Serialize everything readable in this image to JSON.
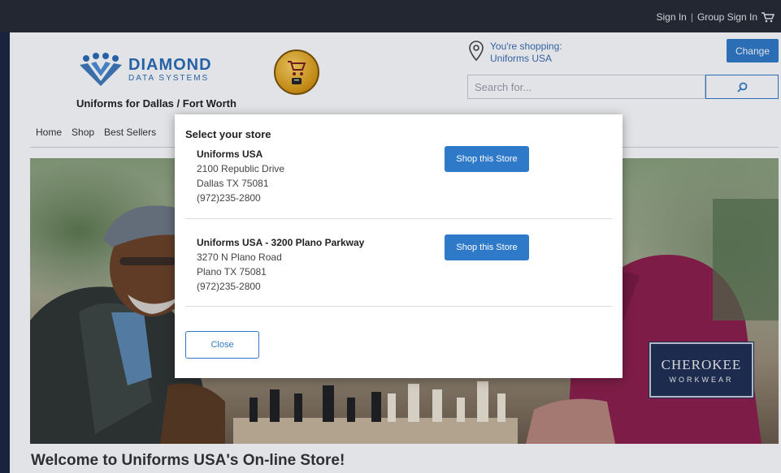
{
  "topbar": {
    "sign_in": "Sign In",
    "separator": "|",
    "group_sign_in": "Group Sign In",
    "cart_icon": "cart-icon"
  },
  "header": {
    "logo": {
      "line1": "DIAMOND",
      "line2": "DATA SYSTEMS"
    },
    "tagline": "Uniforms for Dallas / Fort Worth",
    "location": {
      "line1": "You're shopping:",
      "line2": "Uniforms USA",
      "icon": "map-pin-icon"
    },
    "change_label": "Change",
    "search": {
      "placeholder": "Search for...",
      "icon": "search-icon"
    }
  },
  "nav": {
    "items": [
      "Home",
      "Shop",
      "Best Sellers"
    ]
  },
  "hero": {
    "brand": {
      "line1": "CHEROKEE",
      "line2": "WORKWEAR"
    }
  },
  "welcome": "Welcome to Uniforms USA's On-line Store!",
  "modal": {
    "title": "Select your store",
    "stores": [
      {
        "name": "Uniforms USA",
        "address": "2100 Republic Drive",
        "city": "Dallas TX 75081",
        "phone": "(972)235-2800",
        "button": "Shop this Store"
      },
      {
        "name": "Uniforms USA - 3200 Plano Parkway",
        "address": "3270 N Plano Road",
        "city": "Plano TX 75081",
        "phone": "(972)235-2800",
        "button": "Shop this Store"
      }
    ],
    "close_label": "Close"
  },
  "colors": {
    "accent": "#2f7ac8",
    "topbar": "#262a31",
    "frame": "#1b2540"
  }
}
